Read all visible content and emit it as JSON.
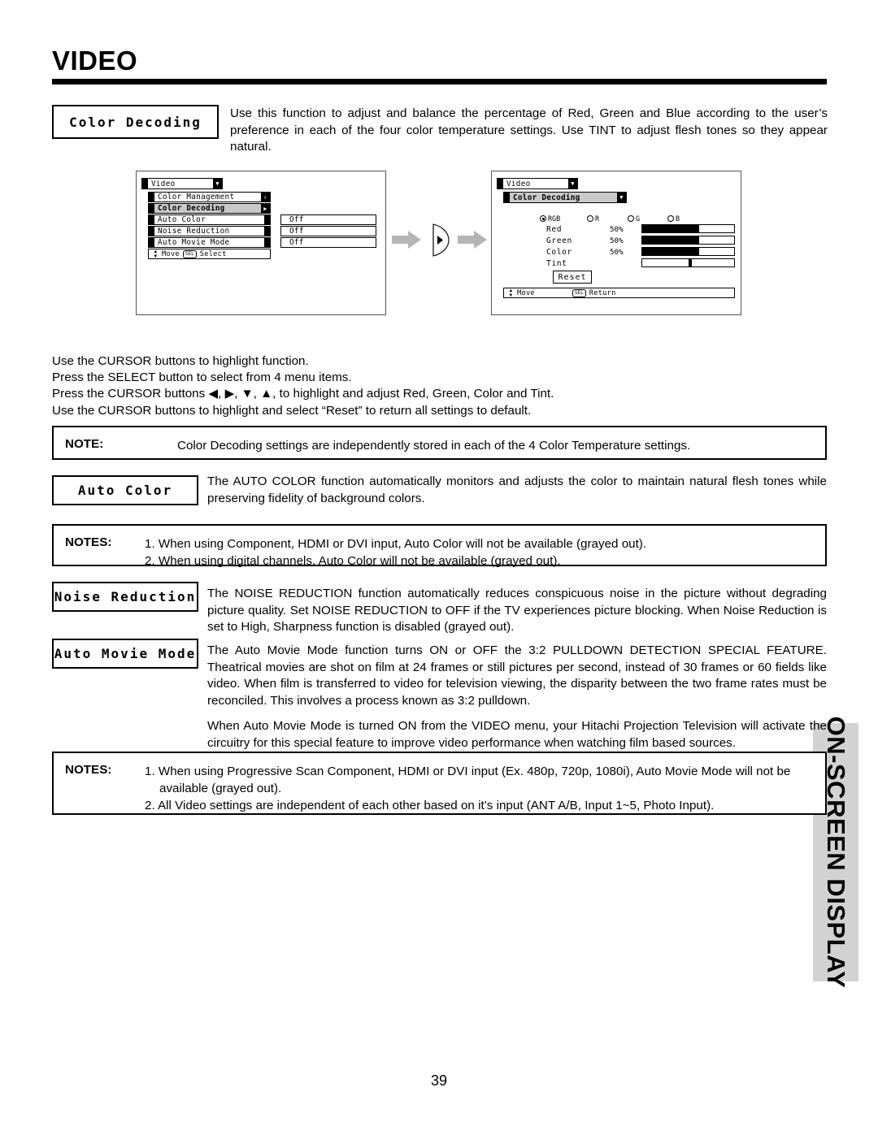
{
  "page": {
    "title": "VIDEO",
    "number": "39",
    "side_tab": "ON-SCREEN DISPLAY"
  },
  "sections": {
    "color_decoding": {
      "label": "Color Decoding",
      "body": "Use this function to adjust and balance the percentage of Red, Green and Blue according to the user’s preference in each of the four color temperature settings.  Use TINT to adjust flesh tones so they appear natural."
    },
    "auto_color": {
      "label": "Auto Color",
      "body": "The AUTO COLOR function automatically monitors and adjusts the color to maintain natural flesh tones while preserving fidelity of background colors."
    },
    "noise_reduction": {
      "label": "Noise Reduction",
      "body": "The NOISE REDUCTION function automatically reduces conspicuous noise in the picture without degrading picture quality.  Set NOISE REDUCTION to OFF if the TV experiences picture blocking.  When Noise Reduction is set to High, Sharpness function is disabled (grayed out)."
    },
    "auto_movie_mode": {
      "label": "Auto Movie Mode",
      "body": "The Auto Movie Mode function turns ON or OFF the 3:2 PULLDOWN DETECTION SPECIAL FEATURE.  Theatrical movies are shot on film at 24 frames or still pictures per second, instead of 30 frames or 60 fields like video.  When film is transferred to video for television viewing, the disparity between the two frame rates must be reconciled.  This involves a process known as 3:2 pulldown.",
      "body2": "When Auto Movie Mode is turned ON from the VIDEO menu, your Hitachi Projection Television will activate the circuitry for this special feature to improve video performance when watching film based sources."
    }
  },
  "instructions": [
    "Use the CURSOR buttons to highlight function.",
    "Press the SELECT button to select from 4 menu items.",
    "Press the CURSOR buttons ◀, ▶, ▼, ▲, to highlight and adjust Red, Green, Color and Tint.",
    "Use the CURSOR buttons to highlight and select “Reset” to return all settings to default."
  ],
  "notes": {
    "note1": {
      "label": "NOTE:",
      "items": [
        "Color Decoding settings are independently stored in each of the 4 Color Temperature settings."
      ]
    },
    "note2": {
      "label": "NOTES:",
      "items": [
        "1. When using Component, HDMI or DVI input, Auto Color will not be available (grayed out).",
        "2. When using digital channels, Auto Color will not be available (grayed out)."
      ]
    },
    "note3": {
      "label": "NOTES:",
      "items": [
        "1. When using Progressive Scan Component, HDMI or DVI input (Ex. 480p, 720p, 1080i), Auto Movie Mode will not be",
        "available (grayed out).",
        "2. All Video settings are independent of each other based on it’s input (ANT A/B, Input 1~5, Photo Input)."
      ]
    }
  },
  "osd_left": {
    "header": "Video",
    "rows": [
      {
        "label": "Color Management",
        "selected": false,
        "marker": "scroll"
      },
      {
        "label": "Color Decoding",
        "selected": true,
        "marker": "arrow"
      },
      {
        "label": "Auto Color",
        "selected": false,
        "marker": "tab",
        "value": "Off"
      },
      {
        "label": "Noise Reduction",
        "selected": false,
        "marker": "tab",
        "value": "Off"
      },
      {
        "label": "Auto Movie Mode",
        "selected": false,
        "marker": "tab",
        "value": "Off"
      }
    ],
    "statusbar": {
      "move": "Move",
      "key": "SEL",
      "action": "Select"
    }
  },
  "osd_right": {
    "header": "Video",
    "subheader": "Color Decoding",
    "radios": [
      {
        "label": "RGB",
        "selected": true
      },
      {
        "label": "R",
        "selected": false
      },
      {
        "label": "G",
        "selected": false
      },
      {
        "label": "B",
        "selected": false
      }
    ],
    "sliders": [
      {
        "label": "Red",
        "percent": "50%",
        "fill": 62
      },
      {
        "label": "Green",
        "percent": "50%",
        "fill": 62
      },
      {
        "label": "Color",
        "percent": "50%",
        "fill": 62
      },
      {
        "label": "Tint",
        "percent": "",
        "fill": 0,
        "thumb": 50
      }
    ],
    "reset_button": "Reset",
    "statusbar": {
      "move": "Move",
      "key": "SEL",
      "action": "Return"
    }
  },
  "colors": {
    "side_tab_bg": "#d2d2d2",
    "selected_row_bg": "#c9c9c9",
    "arrow_gray": "#b5b5b5",
    "osd_border": "#555555"
  }
}
